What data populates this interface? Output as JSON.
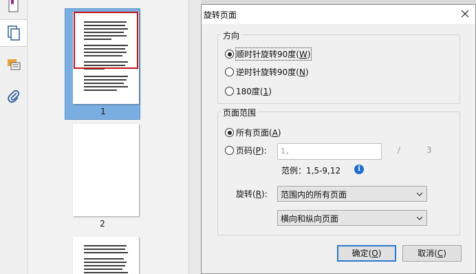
{
  "dialog": {
    "title": "旋转页面",
    "close_icon": "close-icon"
  },
  "direction_group": {
    "legend": "方向",
    "options": [
      {
        "text": "顺时针旋转90度(",
        "key": "W",
        "close": ")",
        "selected": true
      },
      {
        "text": "逆时针旋转90度(",
        "key": "N",
        "close": ")",
        "selected": false
      },
      {
        "text": "180度(",
        "key": "1",
        "close": ")",
        "selected": false
      }
    ]
  },
  "range_group": {
    "legend": "页面范围",
    "all_pages": {
      "text": "所有页面(",
      "key": "A",
      "close": ")",
      "selected": true
    },
    "page_code": {
      "text": "页码(",
      "key": "P",
      "close": "):",
      "selected": false
    },
    "page_input_value": "1,",
    "separator": "/",
    "total_pages": "3",
    "example_label": "范例：1,5-9,12",
    "info_icon": "info-icon",
    "rotate_label": {
      "text": "旋转(",
      "key": "R",
      "close": "):"
    },
    "rotate_subset_value": "范围内的所有页面",
    "orientation_value": "横向和纵向页面"
  },
  "buttons": {
    "ok": {
      "text": "确定(",
      "key": "O",
      "close": ")"
    },
    "cancel": {
      "text": "取消(",
      "key": "C",
      "close": ")"
    }
  },
  "thumbnails": {
    "pages": [
      {
        "number": "1",
        "selected": true
      },
      {
        "number": "2",
        "selected": false
      },
      {
        "number": "",
        "selected": false
      }
    ]
  },
  "toolstrip": {
    "icons": [
      "bookmark-icon",
      "pages-icon",
      "comments-icon",
      "attachment-icon"
    ]
  },
  "colors": {
    "selection": "#7aaee0",
    "view_frame": "#c0121b",
    "default_button_border": "#2b77d1",
    "info_icon": "#1f6fd1"
  }
}
